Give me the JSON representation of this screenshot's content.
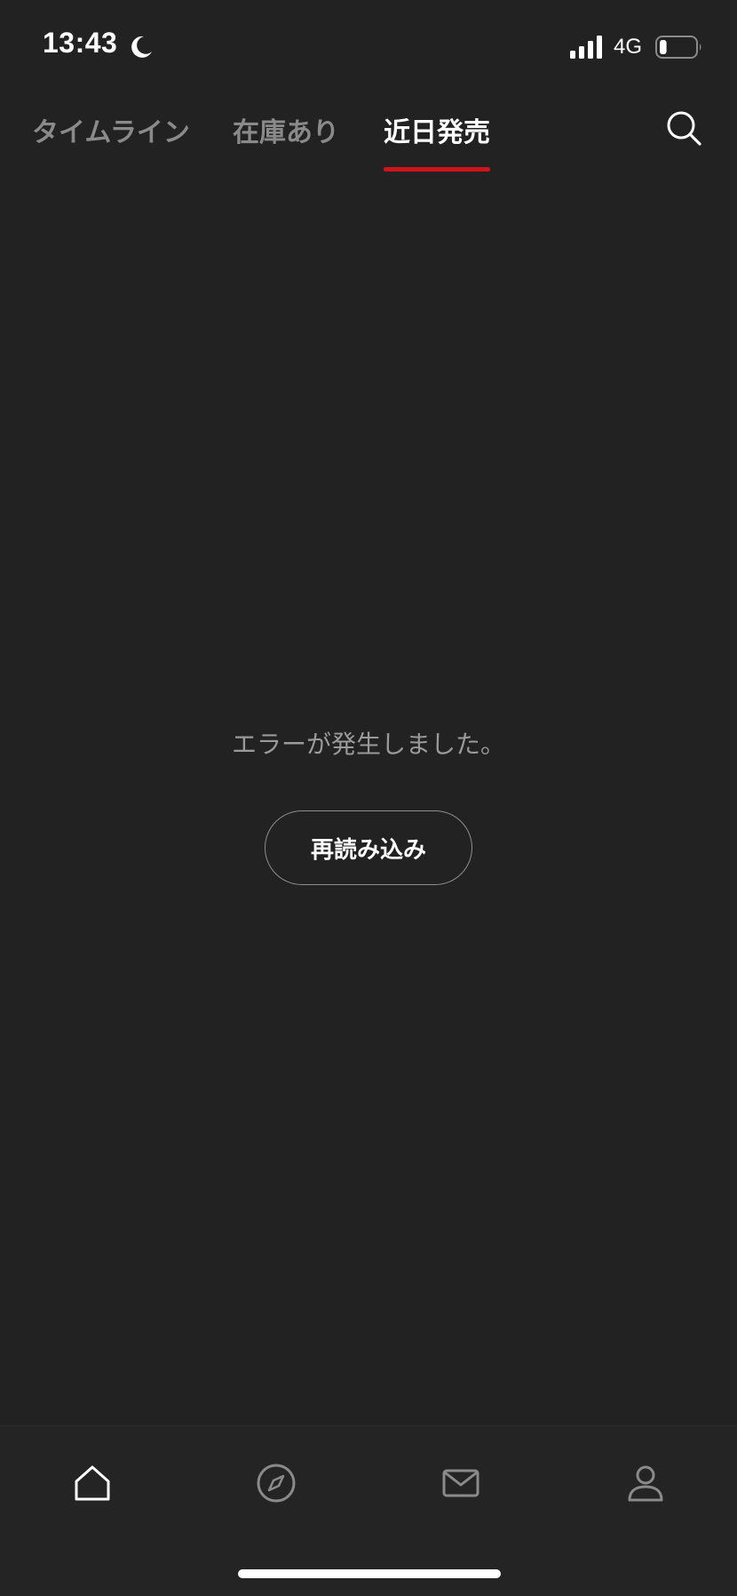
{
  "status_bar": {
    "time": "13:43",
    "network": "4G",
    "icons": [
      "moon-icon",
      "signal-icon",
      "battery-icon"
    ],
    "battery_level": 0.2
  },
  "top_tabs": {
    "items": [
      {
        "label": "タイムライン",
        "active": false
      },
      {
        "label": "在庫あり",
        "active": false
      },
      {
        "label": "近日発売",
        "active": true
      }
    ],
    "indicator_color": "#d0141b",
    "search_icon": "search-icon"
  },
  "main": {
    "error_message": "エラーが発生しました。",
    "reload_label": "再読み込み"
  },
  "bottom_nav": {
    "items": [
      {
        "icon": "home-icon",
        "active": true
      },
      {
        "icon": "compass-icon",
        "active": false
      },
      {
        "icon": "mail-icon",
        "active": false
      },
      {
        "icon": "person-icon",
        "active": false
      }
    ]
  },
  "colors": {
    "background": "#222222",
    "accent": "#d0141b",
    "inactive_text": "#8a8a8a",
    "active_text": "#ffffff"
  }
}
